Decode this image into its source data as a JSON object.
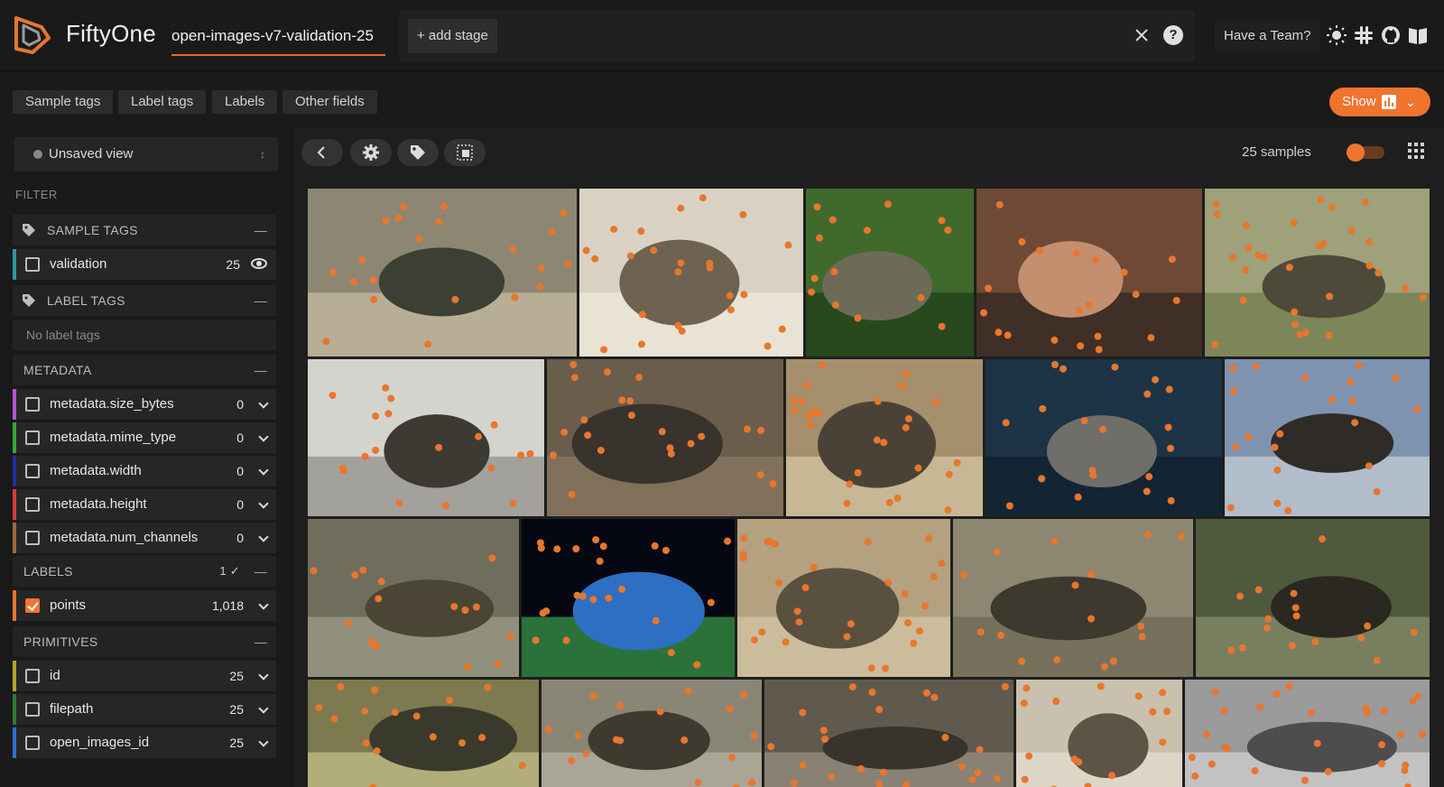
{
  "header": {
    "brand": "FiftyOne",
    "dataset": "open-images-v7-validation-25",
    "add_stage": "+ add stage",
    "team_button": "Have a Team?",
    "icons": [
      "sun-icon",
      "slack-icon",
      "github-icon",
      "docs-icon"
    ]
  },
  "field_tabs": [
    "Sample tags",
    "Label tags",
    "Labels",
    "Other fields"
  ],
  "show_button": "Show",
  "sidebar": {
    "view_selector": "Unsaved view",
    "filter_label": "FILTER",
    "sample_tags": {
      "title": "SAMPLE TAGS",
      "item": "validation",
      "count": "25"
    },
    "label_tags": {
      "title": "LABEL TAGS",
      "empty": "No label tags"
    },
    "metadata": {
      "title": "METADATA",
      "items": [
        {
          "name": "metadata.size_bytes",
          "count": "0",
          "color": "#b455d6"
        },
        {
          "name": "metadata.mime_type",
          "count": "0",
          "color": "#3aa63a"
        },
        {
          "name": "metadata.width",
          "count": "0",
          "color": "#1f2fa8"
        },
        {
          "name": "metadata.height",
          "count": "0",
          "color": "#d63b3b"
        },
        {
          "name": "metadata.num_channels",
          "count": "0",
          "color": "#9a6a3b"
        }
      ]
    },
    "labels": {
      "title": "LABELS",
      "selected": "1 ✓",
      "item": "points",
      "count": "1,018",
      "color": "#e8762e"
    },
    "primitives": {
      "title": "PRIMITIVES",
      "items": [
        {
          "name": "id",
          "count": "25",
          "color": "#b3a52a"
        },
        {
          "name": "filepath",
          "count": "25",
          "color": "#2e7a2e"
        },
        {
          "name": "open_images_id",
          "count": "25",
          "color": "#2b6fd6"
        }
      ]
    }
  },
  "toolbar": {
    "samples_count": "25 samples"
  },
  "colors": {
    "accent": "#f0742e",
    "point": "#e8762e"
  }
}
